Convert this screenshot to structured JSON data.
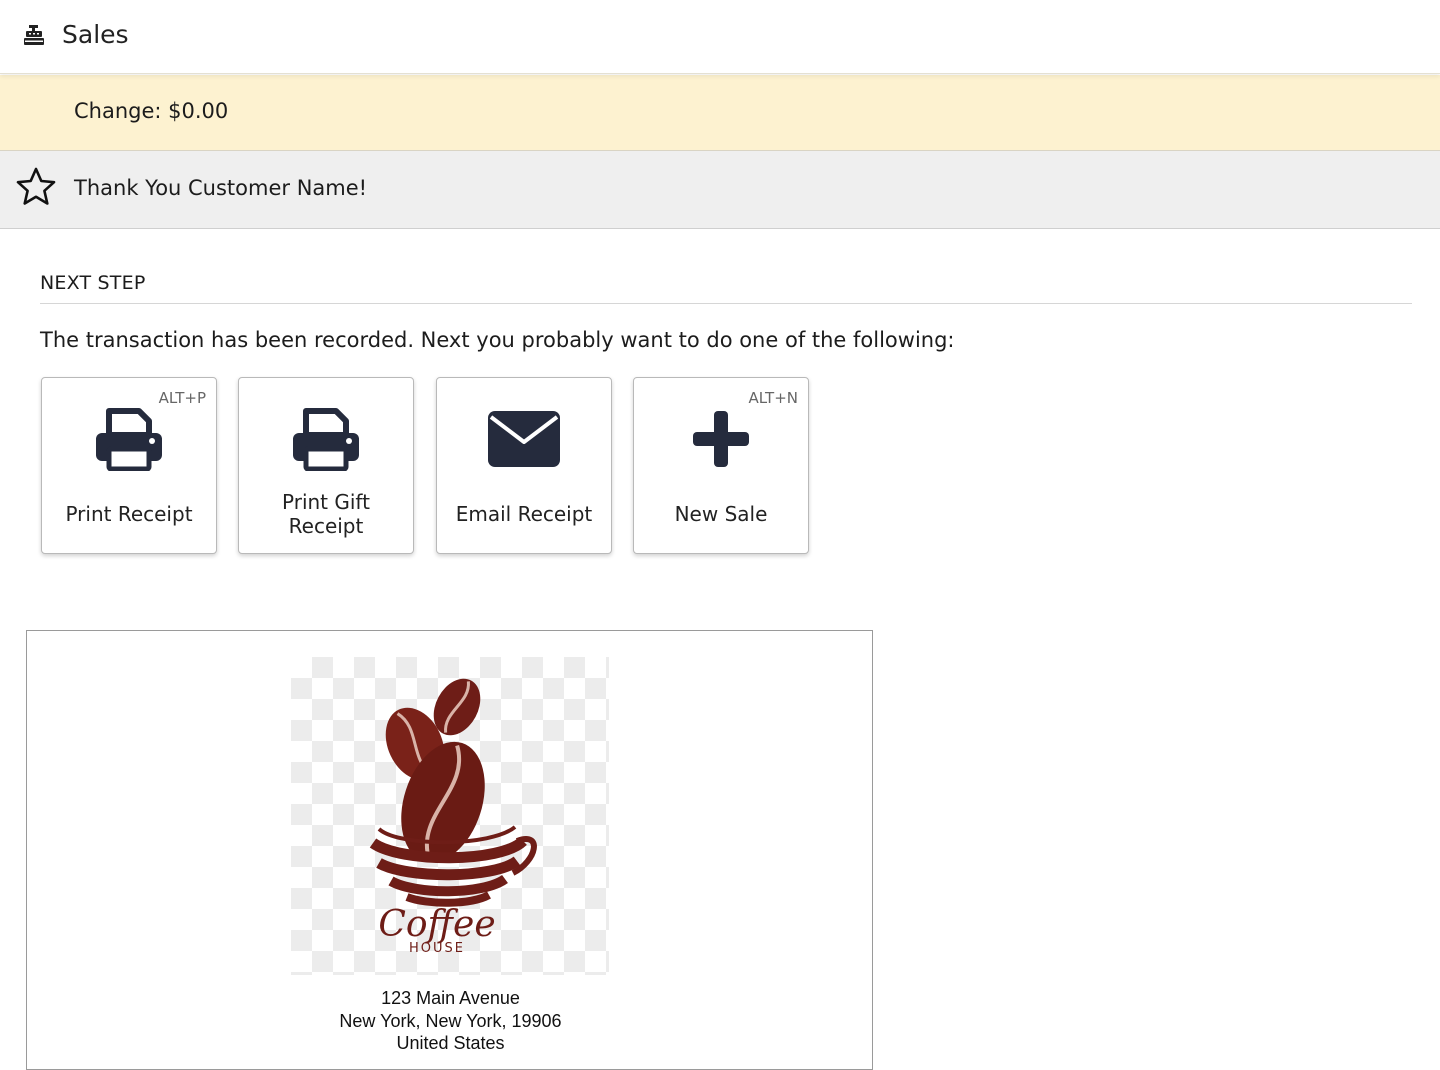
{
  "header": {
    "title": "Sales",
    "icon": "cash-register-icon"
  },
  "change": {
    "label": "Change: $0.00"
  },
  "thanks": {
    "message": "Thank You Customer Name!",
    "icon": "star-outline-icon"
  },
  "next_step": {
    "heading": "NEXT STEP",
    "instructions": "The transaction has been recorded. Next you probably want to do one of the following:"
  },
  "actions": [
    {
      "label": "Print Receipt",
      "shortcut": "ALT+P",
      "icon": "printer-icon"
    },
    {
      "label": "Print Gift Receipt",
      "shortcut": "",
      "icon": "printer-icon"
    },
    {
      "label": "Email Receipt",
      "shortcut": "",
      "icon": "envelope-icon"
    },
    {
      "label": "New Sale",
      "shortcut": "ALT+N",
      "icon": "plus-icon"
    }
  ],
  "receipt": {
    "logo_text": "Coffee",
    "logo_subtext": "HOUSE",
    "address_line1": "123 Main Avenue",
    "address_line2": "New York, New York, 19906",
    "address_line3": "United States"
  },
  "colors": {
    "change_bar_bg": "#fdf2d0",
    "thanks_bar_bg": "#efefef",
    "icon_navy": "#252b3d",
    "coffee_brown": "#6e1d17"
  }
}
